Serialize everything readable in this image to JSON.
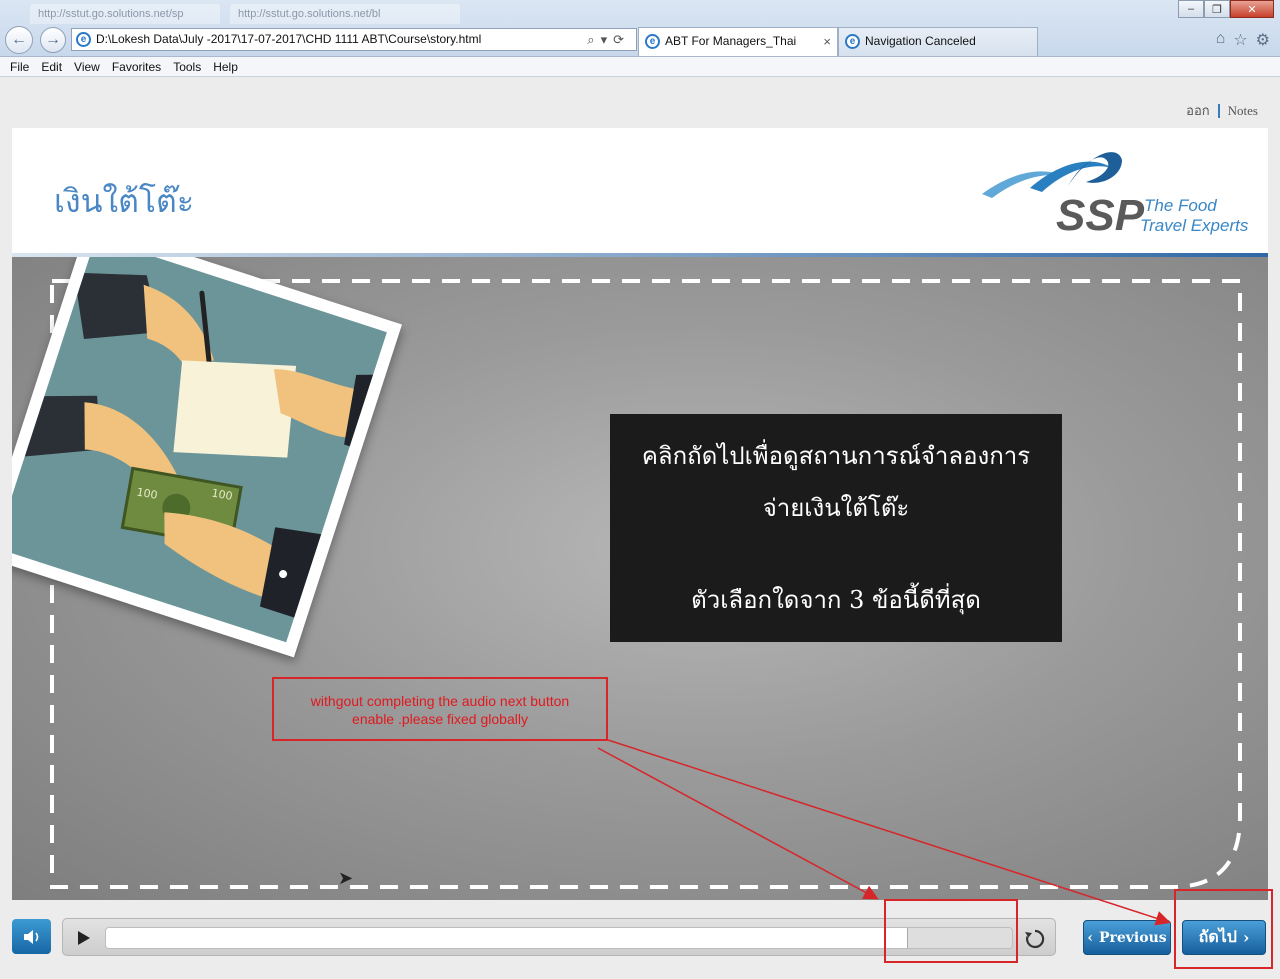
{
  "browser": {
    "bg_tabs": [
      "http://sstut.go.solutions.net/sp",
      "http://sstut.go.solutions.net/bl"
    ],
    "address": "D:\\Lokesh Data\\July -2017\\17-07-2017\\CHD 1111 ABT\\Course\\story.html",
    "tabs": [
      {
        "label": "ABT For Managers_Thai",
        "active": true
      },
      {
        "label": "Navigation Canceled",
        "active": false
      }
    ],
    "menu": [
      "File",
      "Edit",
      "View",
      "Favorites",
      "Tools",
      "Help"
    ]
  },
  "player": {
    "top_links": {
      "exit": "ออก",
      "notes": "Notes"
    },
    "slide_title": "เงินใต้โต๊ะ",
    "logo": {
      "brand": "SSP",
      "tagline_1": "The Food",
      "tagline_2": "Travel Experts"
    },
    "message": {
      "line1": "คลิกถัดไปเพื่อดูสถานการณ์จำลองการ",
      "line2": "จ่ายเงินใต้โต๊ะ",
      "line3": "ตัวเลือกใดจาก 3 ข้อนี้ดีที่สุด"
    },
    "seek_progress": 0.885,
    "prev_label": "Previous",
    "next_label": "ถัดไป"
  },
  "annotation": {
    "text_line1": "withgout completing the audio next button",
    "text_line2": "enable .please fixed globally",
    "color": "#d7262a"
  }
}
